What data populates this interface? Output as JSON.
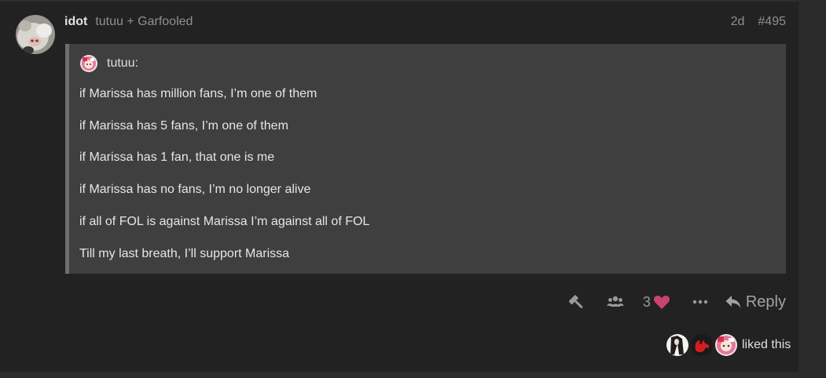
{
  "post": {
    "username": "idot",
    "reply_to": "tutuu + Garfooled",
    "age": "2d",
    "post_number": "#495",
    "avatar_icon": "cat-avatar-icon"
  },
  "quote": {
    "author": "tutuu:",
    "lines": [
      "if Marissa has million fans, I’m one of them",
      "if Marissa has 5 fans, I’m one of them",
      "if Marissa has 1 fan, that one is me",
      "if Marissa has no fans, I’m no longer alive",
      "if all of FOL is against Marissa I’m against all of FOL",
      "Till my last breath, I’ll support Marissa"
    ]
  },
  "actions": {
    "flag_icon": "hammer-icon",
    "share_icon": "users-icon",
    "like_count": "3",
    "like_icon": "heart-icon",
    "more_icon": "ellipsis-icon",
    "reply_label": "Reply",
    "reply_icon": "reply-arrow-icon"
  },
  "likers": {
    "label": "liked this",
    "avatars": [
      "liker-avatar-1",
      "liker-avatar-2",
      "liker-avatar-3"
    ]
  },
  "colors": {
    "background": "#222222",
    "quote_bg": "#3f3f3f",
    "quote_border": "#6f6f6f",
    "like_heart": "#c9436f",
    "muted_text": "#8f8f8f"
  }
}
